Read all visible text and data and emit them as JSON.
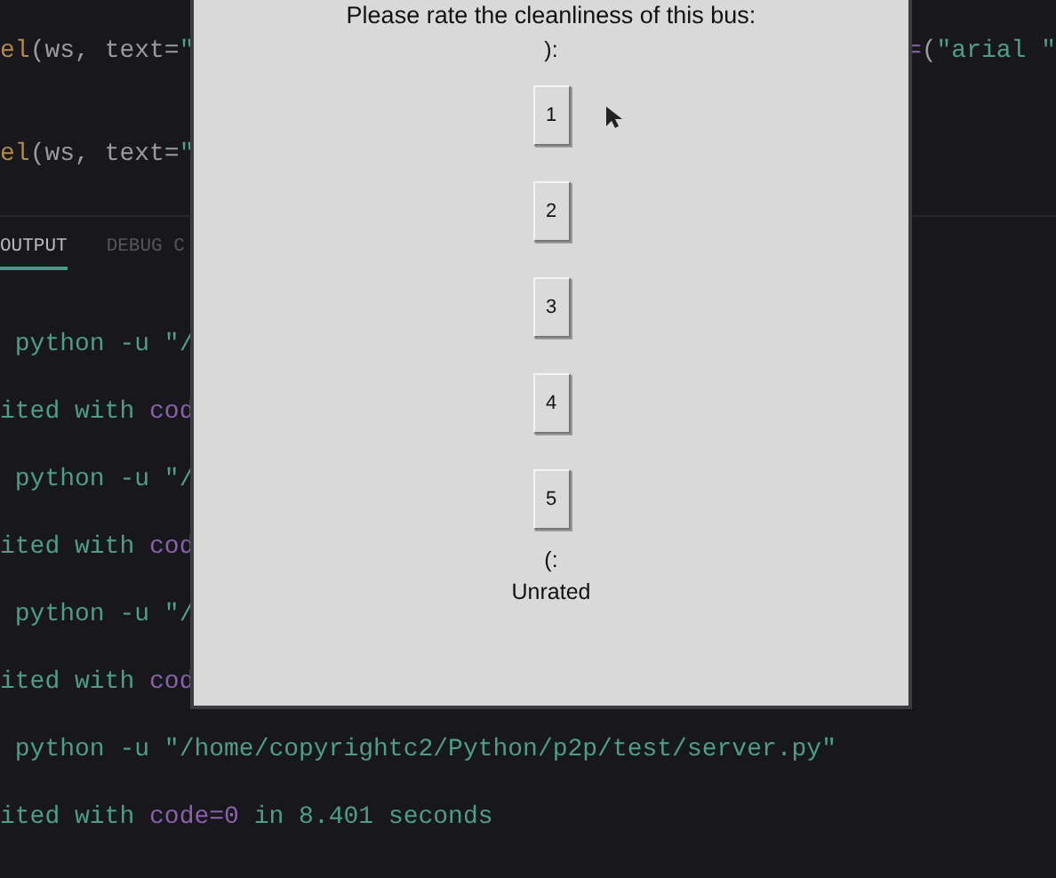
{
  "editor": {
    "lines": [
      {
        "left": [
          {
            "text": "el",
            "kind": "function"
          },
          {
            "text": "(ws, text=",
            "kind": "plain"
          },
          {
            "text": "\"",
            "kind": "string"
          }
        ],
        "right": [
          {
            "text": "=",
            "kind": "keyword"
          },
          {
            "text": "(",
            "kind": "plain"
          },
          {
            "text": "\"arial \"",
            "kind": "string"
          }
        ]
      },
      {
        "left": [
          {
            "text": "el",
            "kind": "function"
          },
          {
            "text": "(ws, text=",
            "kind": "plain"
          },
          {
            "text": "\"",
            "kind": "string"
          }
        ]
      }
    ]
  },
  "panel_tabs": [
    {
      "label": "OUTPUT",
      "selected": true
    },
    {
      "label": "DEBUG C",
      "selected": false
    }
  ],
  "terminal": {
    "lines": [
      [
        {
          "text": " python -u \"/",
          "kind": "string"
        }
      ],
      [
        {
          "text": "ited with ",
          "kind": "string"
        },
        {
          "text": "cod",
          "kind": "keyword"
        }
      ],
      [
        {
          "text": " python -u \"/",
          "kind": "string"
        }
      ],
      [
        {
          "text": "ited with ",
          "kind": "string"
        },
        {
          "text": "cod",
          "kind": "keyword"
        }
      ],
      [
        {
          "text": " python -u \"/",
          "kind": "string"
        }
      ],
      [
        {
          "text": "ited with ",
          "kind": "string"
        },
        {
          "text": "cod",
          "kind": "keyword"
        }
      ],
      [
        {
          "text": " python -u \"/home/copyrightc2/Python/p2p/test/server.py\"",
          "kind": "string"
        }
      ],
      [
        {
          "text": "ited with ",
          "kind": "string"
        },
        {
          "text": "code=0",
          "kind": "keyword"
        },
        {
          "text": " in 8.401 seconds",
          "kind": "string"
        }
      ]
    ]
  },
  "dialog": {
    "prompt": "Please rate the cleanliness of this bus:",
    "top_text": "):",
    "buttons": [
      "1",
      "2",
      "3",
      "4",
      "5"
    ],
    "bottom_text": "(:",
    "status": "Unrated"
  }
}
